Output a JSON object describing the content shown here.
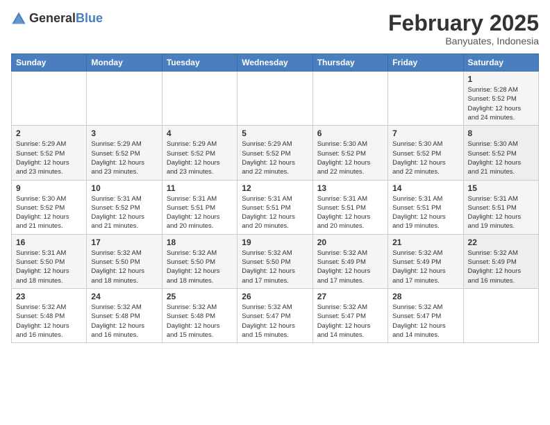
{
  "logo": {
    "general": "General",
    "blue": "Blue"
  },
  "title": "February 2025",
  "subtitle": "Banyuates, Indonesia",
  "weekdays": [
    "Sunday",
    "Monday",
    "Tuesday",
    "Wednesday",
    "Thursday",
    "Friday",
    "Saturday"
  ],
  "weeks": [
    [
      {
        "day": "",
        "info": ""
      },
      {
        "day": "",
        "info": ""
      },
      {
        "day": "",
        "info": ""
      },
      {
        "day": "",
        "info": ""
      },
      {
        "day": "",
        "info": ""
      },
      {
        "day": "",
        "info": ""
      },
      {
        "day": "1",
        "info": "Sunrise: 5:28 AM\nSunset: 5:52 PM\nDaylight: 12 hours\nand 24 minutes."
      }
    ],
    [
      {
        "day": "2",
        "info": "Sunrise: 5:29 AM\nSunset: 5:52 PM\nDaylight: 12 hours\nand 23 minutes."
      },
      {
        "day": "3",
        "info": "Sunrise: 5:29 AM\nSunset: 5:52 PM\nDaylight: 12 hours\nand 23 minutes."
      },
      {
        "day": "4",
        "info": "Sunrise: 5:29 AM\nSunset: 5:52 PM\nDaylight: 12 hours\nand 23 minutes."
      },
      {
        "day": "5",
        "info": "Sunrise: 5:29 AM\nSunset: 5:52 PM\nDaylight: 12 hours\nand 22 minutes."
      },
      {
        "day": "6",
        "info": "Sunrise: 5:30 AM\nSunset: 5:52 PM\nDaylight: 12 hours\nand 22 minutes."
      },
      {
        "day": "7",
        "info": "Sunrise: 5:30 AM\nSunset: 5:52 PM\nDaylight: 12 hours\nand 22 minutes."
      },
      {
        "day": "8",
        "info": "Sunrise: 5:30 AM\nSunset: 5:52 PM\nDaylight: 12 hours\nand 21 minutes."
      }
    ],
    [
      {
        "day": "9",
        "info": "Sunrise: 5:30 AM\nSunset: 5:52 PM\nDaylight: 12 hours\nand 21 minutes."
      },
      {
        "day": "10",
        "info": "Sunrise: 5:31 AM\nSunset: 5:52 PM\nDaylight: 12 hours\nand 21 minutes."
      },
      {
        "day": "11",
        "info": "Sunrise: 5:31 AM\nSunset: 5:51 PM\nDaylight: 12 hours\nand 20 minutes."
      },
      {
        "day": "12",
        "info": "Sunrise: 5:31 AM\nSunset: 5:51 PM\nDaylight: 12 hours\nand 20 minutes."
      },
      {
        "day": "13",
        "info": "Sunrise: 5:31 AM\nSunset: 5:51 PM\nDaylight: 12 hours\nand 20 minutes."
      },
      {
        "day": "14",
        "info": "Sunrise: 5:31 AM\nSunset: 5:51 PM\nDaylight: 12 hours\nand 19 minutes."
      },
      {
        "day": "15",
        "info": "Sunrise: 5:31 AM\nSunset: 5:51 PM\nDaylight: 12 hours\nand 19 minutes."
      }
    ],
    [
      {
        "day": "16",
        "info": "Sunrise: 5:31 AM\nSunset: 5:50 PM\nDaylight: 12 hours\nand 18 minutes."
      },
      {
        "day": "17",
        "info": "Sunrise: 5:32 AM\nSunset: 5:50 PM\nDaylight: 12 hours\nand 18 minutes."
      },
      {
        "day": "18",
        "info": "Sunrise: 5:32 AM\nSunset: 5:50 PM\nDaylight: 12 hours\nand 18 minutes."
      },
      {
        "day": "19",
        "info": "Sunrise: 5:32 AM\nSunset: 5:50 PM\nDaylight: 12 hours\nand 17 minutes."
      },
      {
        "day": "20",
        "info": "Sunrise: 5:32 AM\nSunset: 5:49 PM\nDaylight: 12 hours\nand 17 minutes."
      },
      {
        "day": "21",
        "info": "Sunrise: 5:32 AM\nSunset: 5:49 PM\nDaylight: 12 hours\nand 17 minutes."
      },
      {
        "day": "22",
        "info": "Sunrise: 5:32 AM\nSunset: 5:49 PM\nDaylight: 12 hours\nand 16 minutes."
      }
    ],
    [
      {
        "day": "23",
        "info": "Sunrise: 5:32 AM\nSunset: 5:48 PM\nDaylight: 12 hours\nand 16 minutes."
      },
      {
        "day": "24",
        "info": "Sunrise: 5:32 AM\nSunset: 5:48 PM\nDaylight: 12 hours\nand 16 minutes."
      },
      {
        "day": "25",
        "info": "Sunrise: 5:32 AM\nSunset: 5:48 PM\nDaylight: 12 hours\nand 15 minutes."
      },
      {
        "day": "26",
        "info": "Sunrise: 5:32 AM\nSunset: 5:47 PM\nDaylight: 12 hours\nand 15 minutes."
      },
      {
        "day": "27",
        "info": "Sunrise: 5:32 AM\nSunset: 5:47 PM\nDaylight: 12 hours\nand 14 minutes."
      },
      {
        "day": "28",
        "info": "Sunrise: 5:32 AM\nSunset: 5:47 PM\nDaylight: 12 hours\nand 14 minutes."
      },
      {
        "day": "",
        "info": ""
      }
    ]
  ]
}
